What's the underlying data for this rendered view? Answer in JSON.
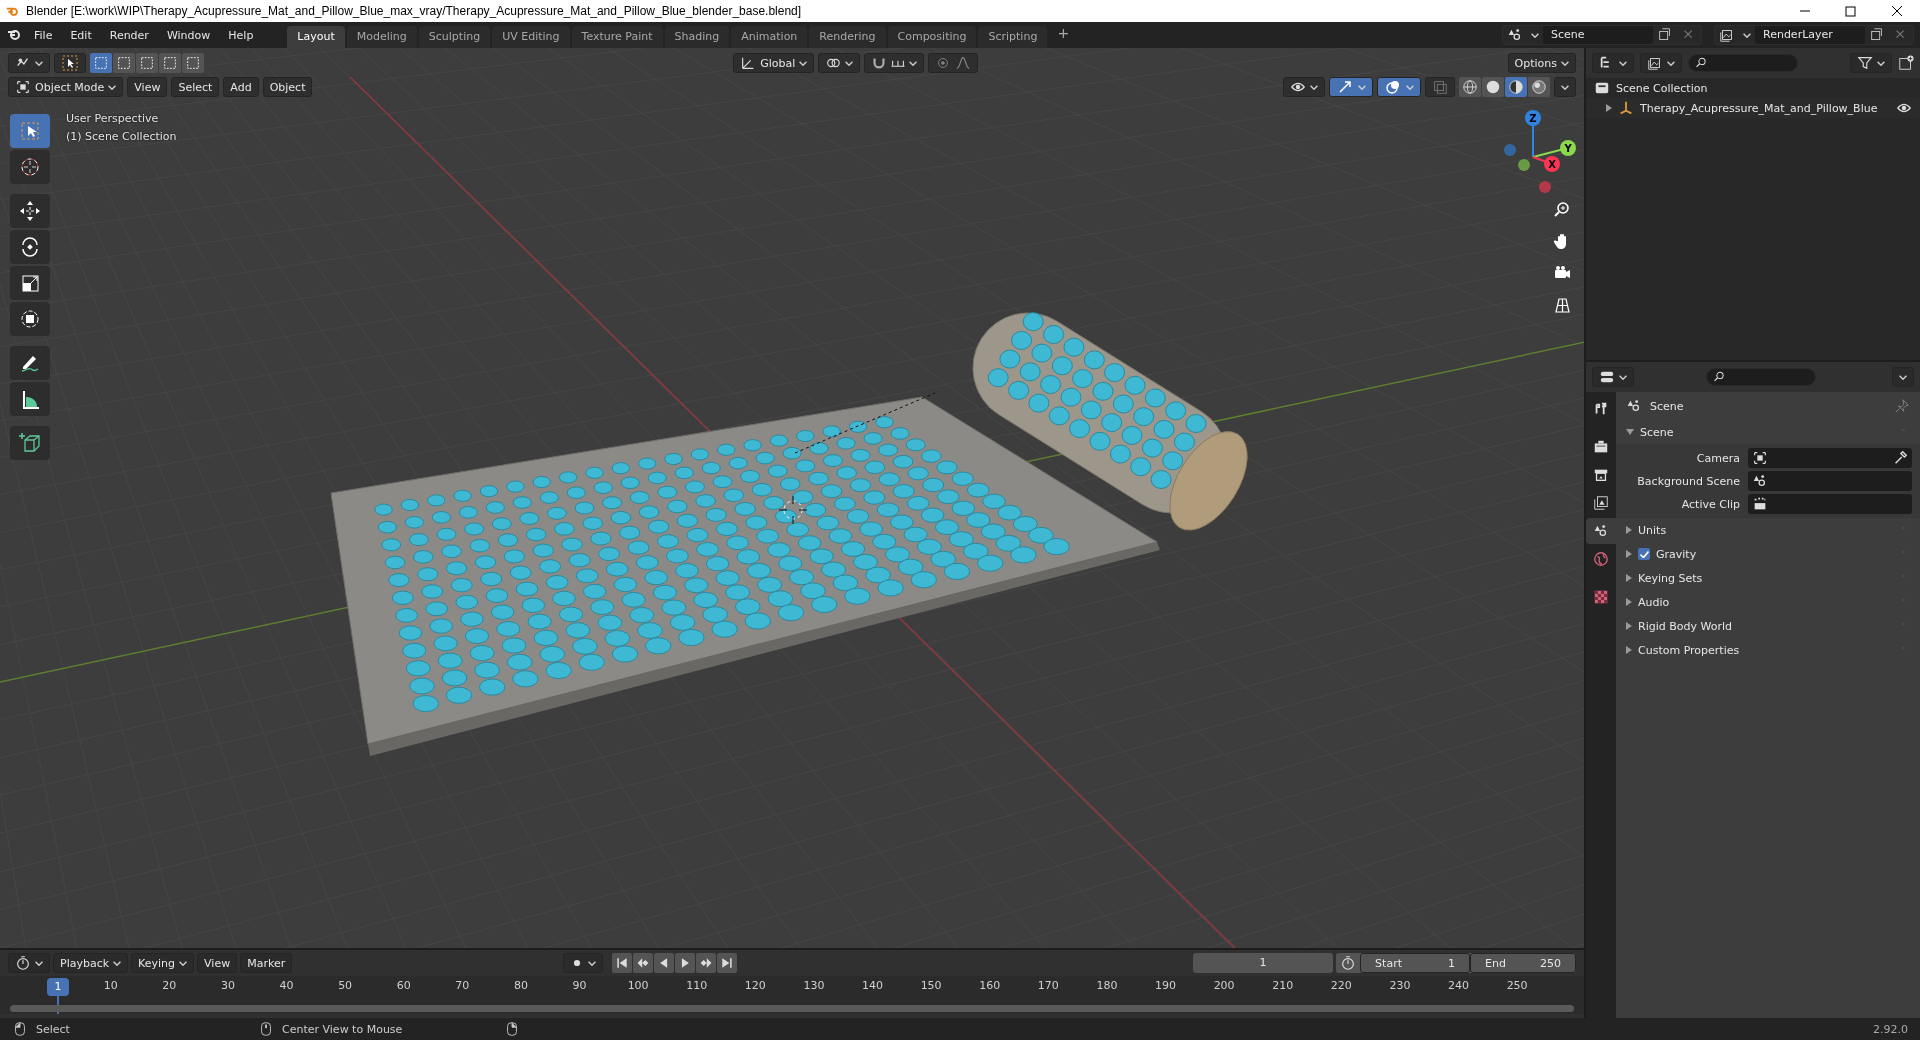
{
  "window": {
    "title": "Blender [E:\\work\\WIP\\Therapy_Acupressure_Mat_and_Pillow_Blue_max_vray/Therapy_Acupressure_Mat_and_Pillow_Blue_blender_base.blend]"
  },
  "menu": [
    "File",
    "Edit",
    "Render",
    "Window",
    "Help"
  ],
  "workspaces": [
    {
      "label": "Layout",
      "selected": true
    },
    {
      "label": "Modeling",
      "selected": false
    },
    {
      "label": "Sculpting",
      "selected": false
    },
    {
      "label": "UV Editing",
      "selected": false
    },
    {
      "label": "Texture Paint",
      "selected": false
    },
    {
      "label": "Shading",
      "selected": false
    },
    {
      "label": "Animation",
      "selected": false
    },
    {
      "label": "Rendering",
      "selected": false
    },
    {
      "label": "Compositing",
      "selected": false
    },
    {
      "label": "Scripting",
      "selected": false
    }
  ],
  "add_workspace": "+",
  "scene": "Scene",
  "view_layer": "RenderLayer",
  "viewport": {
    "mode": "Object Mode",
    "menus": [
      "View",
      "Select",
      "Add",
      "Object"
    ],
    "orientation": "Global",
    "options": "Options",
    "info": [
      "User Perspective",
      "(1) Scene Collection"
    ],
    "gizmos_on": true,
    "overlays_on": true,
    "xray_on": false,
    "select_modes": [
      {
        "selected": true
      },
      {
        "selected": false
      },
      {
        "selected": false
      },
      {
        "selected": false
      },
      {
        "selected": false
      }
    ],
    "shading": [
      {
        "kind": "wireframe",
        "selected": false
      },
      {
        "kind": "solid",
        "selected": false
      },
      {
        "kind": "material",
        "selected": true
      },
      {
        "kind": "rendered",
        "selected": false
      }
    ],
    "tools": [
      {
        "kind": "select",
        "selected": true
      },
      {
        "kind": "cursor",
        "selected": false
      },
      {
        "kind": "move",
        "selected": false
      },
      {
        "kind": "rotate",
        "selected": false
      },
      {
        "kind": "scale",
        "selected": false
      },
      {
        "kind": "transform",
        "selected": false
      },
      {
        "kind": "annotate",
        "selected": false
      },
      {
        "kind": "measure",
        "selected": false
      },
      {
        "kind": "add-cube",
        "selected": false
      }
    ],
    "axes": [
      {
        "label": "Z",
        "color": "#2f83e3"
      },
      {
        "label": "Y",
        "color": "#8bd94a"
      },
      {
        "label": "X",
        "color": "#ff3352"
      }
    ]
  },
  "outliner": {
    "root": "Scene Collection",
    "items": [
      {
        "label": "Therapy_Acupressure_Mat_and_Pillow_Blue",
        "expanded": false
      }
    ]
  },
  "properties": {
    "context": "Scene",
    "tabs": [
      {
        "kind": "tool",
        "selected": false
      },
      {
        "kind": "render",
        "selected": false
      },
      {
        "kind": "output",
        "selected": false
      },
      {
        "kind": "view-layer",
        "selected": false
      },
      {
        "kind": "scene",
        "selected": true
      },
      {
        "kind": "world",
        "selected": false
      },
      {
        "kind": "texture",
        "selected": false
      }
    ],
    "panels": [
      {
        "label": "Scene",
        "kind": "plain",
        "expanded": true,
        "fields": [
          {
            "label": "Camera",
            "kind": "camera"
          },
          {
            "label": "Background Scene",
            "kind": "scene"
          },
          {
            "label": "Active Clip",
            "kind": "clip"
          }
        ]
      },
      {
        "label": "Units",
        "kind": "plain",
        "expanded": false
      },
      {
        "label": "Gravity",
        "kind": "checkbox",
        "checked": true,
        "expanded": false
      },
      {
        "label": "Keying Sets",
        "kind": "plain",
        "expanded": false
      },
      {
        "label": "Audio",
        "kind": "plain",
        "expanded": false
      },
      {
        "label": "Rigid Body World",
        "kind": "plain",
        "expanded": false
      },
      {
        "label": "Custom Properties",
        "kind": "plain",
        "expanded": false
      }
    ]
  },
  "timeline": {
    "menus": [
      "Playback",
      "Keying",
      "View",
      "Marker"
    ],
    "current_frame": "1",
    "start_label": "Start",
    "start": "1",
    "end_label": "End",
    "end": "250",
    "playhead": "1",
    "ruler": [
      "10",
      "20",
      "30",
      "40",
      "50",
      "60",
      "70",
      "80",
      "90",
      "100",
      "110",
      "120",
      "130",
      "140",
      "150",
      "160",
      "170",
      "180",
      "190",
      "200",
      "210",
      "220",
      "230",
      "240",
      "250"
    ]
  },
  "status_bar": {
    "items": [
      {
        "kind": "left-mouse",
        "label": "Select"
      },
      {
        "kind": "middle-mouse",
        "label": "Center View to Mouse"
      },
      {
        "kind": "right-mouse"
      }
    ],
    "version": "2.92.0"
  }
}
